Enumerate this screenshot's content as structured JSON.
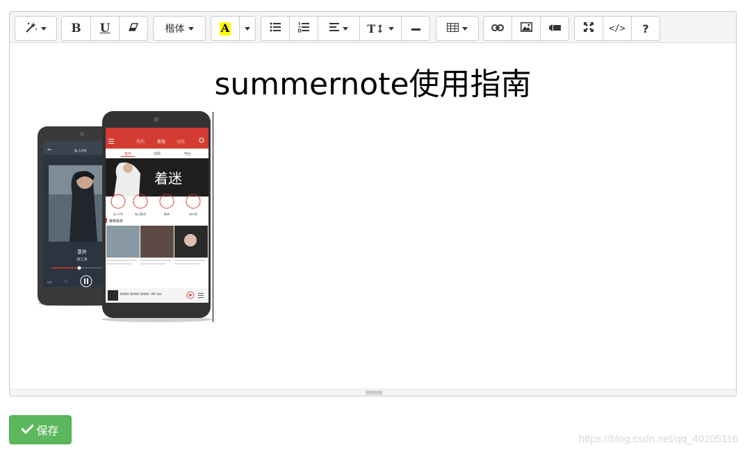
{
  "toolbar": {
    "style_icon": "magic-wand-icon",
    "bold_label": "B",
    "underline_label": "U",
    "clear_icon": "eraser-icon",
    "font_family_label": "楷体",
    "color_label": "A",
    "color_highlight": "#ffff00",
    "list_icons": [
      "unordered-list-icon",
      "ordered-list-icon"
    ],
    "paragraph_icon": "align-left-icon",
    "height_label": "T↕",
    "hr_icon": "horizontal-rule-icon",
    "table_icon": "table-icon",
    "insert_icons": [
      "link-icon",
      "picture-icon",
      "video-icon"
    ],
    "view_icons": [
      "fullscreen-icon",
      "codeview-icon"
    ],
    "codeview_label": "</>",
    "help_label": "?"
  },
  "content": {
    "title": "summernote使用指南",
    "image_alt": "phone-screenshots"
  },
  "phone": {
    "back_song": "意外",
    "back_artist": "薛之谦",
    "tabs": [
      "我的",
      "发现",
      "动态"
    ],
    "subtabs": [
      "音乐",
      "视频",
      "电台"
    ],
    "banner_text": "着迷",
    "nav_items": [
      "私人FM",
      "每日推荐",
      "歌单",
      "排行榜"
    ],
    "section_title": "推荐歌单",
    "now_playing": "BANG BANG BANG -KR Ver.",
    "accent_color": "#d43c33"
  },
  "actions": {
    "save_label": "保存",
    "save_color": "#5cb85c"
  },
  "watermark": "https://blog.csdn.net/qq_40205116"
}
